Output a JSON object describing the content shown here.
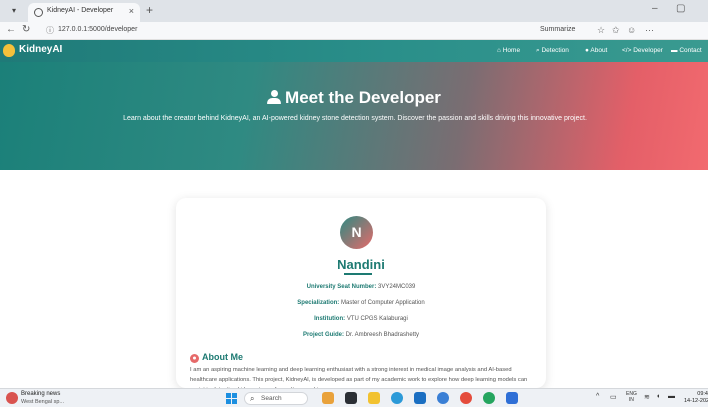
{
  "browser": {
    "tab_title": "KidneyAI - Developer",
    "url": "127.0.0.1:5000/developer",
    "summarize_label": "Summarize",
    "icons": [
      "tab-menu-icon",
      "close-icon",
      "plus-icon",
      "back-icon",
      "refresh-icon",
      "info-icon",
      "star-icon",
      "favorites-icon",
      "extension-icon",
      "more-icon"
    ]
  },
  "site": {
    "logo_text": "KidneyAI",
    "nav": [
      {
        "label": "Home",
        "icon": "home-icon"
      },
      {
        "label": "Detection",
        "icon": "search-icon"
      },
      {
        "label": "About",
        "icon": "info-icon"
      },
      {
        "label": "Developer",
        "icon": "code-icon"
      },
      {
        "label": "Contact",
        "icon": "mail-icon"
      }
    ],
    "colors": {
      "primary": "#1d7a72",
      "accent": "#f26a6f",
      "logo": "#f5c03b"
    }
  },
  "hero": {
    "title": "Meet the Developer",
    "subtitle": "Learn about the creator behind KidneyAI, an AI-powered kidney stone detection system. Discover the passion and skills driving this innovative project."
  },
  "profile": {
    "initial": "N",
    "name": "Nandini",
    "fields": [
      {
        "label": "University Seat Number:",
        "value": "3VY24MC039"
      },
      {
        "label": "Specialization:",
        "value": "Master of Computer Application"
      },
      {
        "label": "Institution:",
        "value": "VTU CPGS Kalaburagi"
      },
      {
        "label": "Project Guide:",
        "value": "Dr. Ambreesh Bhadrashetty"
      }
    ],
    "about_title": "About Me",
    "about_text": "I am an aspiring machine learning and deep learning enthusiast with a strong interest in medical image analysis and AI-based healthcare applications. This project, KidneyAI, is developed as part of my academic work to explore how deep learning models can assist in detecting kidney stones from ultrasound images."
  },
  "taskbar": {
    "news_title": "Breaking news",
    "news_sub": "West Bengal sp...",
    "search_label": "Search",
    "lang_top": "ENG",
    "lang_bottom": "IN",
    "time": "09:4",
    "date": "14-12-202"
  }
}
